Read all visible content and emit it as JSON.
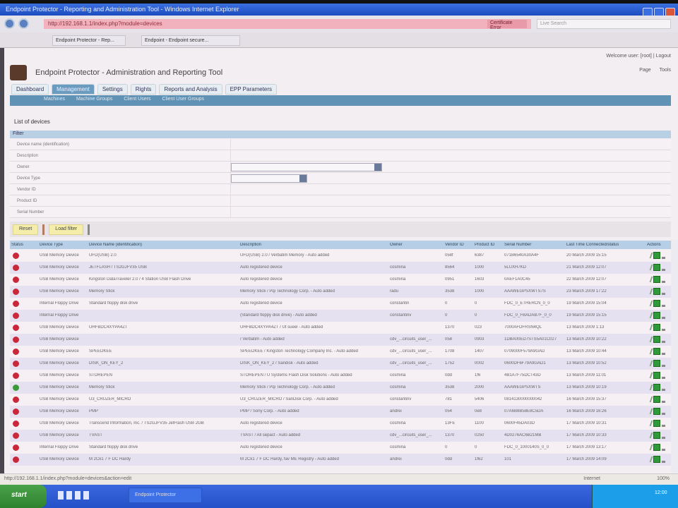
{
  "window": {
    "title": "Endpoint Protector - Reporting and Administration Tool - Windows Internet Explorer"
  },
  "browser": {
    "address": "http://192.168.1.1/index.php?module=devices",
    "cert_error": "Certificate Error",
    "search_placeholder": "Live Search",
    "tabs": [
      "Endpoint Protector - Rep...",
      "Endpoint - Endpoint secure..."
    ],
    "tools": [
      "Page",
      "Tools"
    ]
  },
  "header": {
    "welcome": "Welcome user: [root] | Logout",
    "app_title": "Endpoint Protector - Administration and Reporting Tool"
  },
  "main_tabs": [
    "Dashboard",
    "Management",
    "Settings",
    "Rights",
    "Reports and Analysis",
    "EPP Parameters"
  ],
  "active_tab": "Management",
  "sub_nav": [
    "Machines",
    "Machine Groups",
    "Client Users",
    "Client User Groups"
  ],
  "section_title": "List of devices",
  "filter": {
    "title": "Filter",
    "fields": [
      "Device name (identification)",
      "Description",
      "Owner",
      "Device Type",
      "Vendor ID",
      "Product ID",
      "Serial Number"
    ]
  },
  "buttons": {
    "reset": "Reset",
    "load_filter": "Load filter"
  },
  "table": {
    "columns": [
      "Status",
      "Device Type",
      "Device Name (identification)",
      "Description",
      "Owner",
      "Vendor ID",
      "Product ID",
      "Serial Number",
      "Last Time Connected/status",
      "Actions"
    ],
    "rows": [
      [
        "bad",
        "USB Memory Device",
        "UFD(USB) 2.0",
        "UFD(USB) 2.0 / Verbatim Memory - Auto added",
        "",
        "058f",
        "6387",
        "071B6540A30A4F",
        "20 March 2009 15:15"
      ],
      [
        "bad",
        "USB Memory Device",
        "JETFLASH / TS2GJFV35 USB",
        "Auto registered device",
        "cosmina",
        "8564",
        "1000",
        "5LUXH7KD",
        "21 March 2009 12:07"
      ],
      [
        "bad",
        "USB Memory Device",
        "Kingston DataTraveler 2.0 / 4 Station USB Flash Drive",
        "Auto registered device",
        "cosmina",
        "0951",
        "1603",
        "0AEF1A0C45",
        "22 March 2009 12:07"
      ],
      [
        "bad",
        "USB Memory Device",
        "Memory Stick",
        "Memory Stick / Pqi Technology Corp. - Auto added",
        "radu",
        "3538",
        "1000",
        "AAAWEGPSXWTS7S",
        "23 March 2009 17:22"
      ],
      [
        "bad",
        "Internal Floppy Drive",
        "Standard floppy disk drive",
        "Auto registered device",
        "constantin",
        "0",
        "0",
        "FDC_0_ETHERCN_0_0",
        "19 March 2009 15:04"
      ],
      [
        "bad",
        "Internal Floppy Drive",
        "",
        "(Standard floppy disk drive) - Auto added",
        "constantinv",
        "0",
        "0",
        "FDC_0_FBADAB7F_0_0",
        "19 March 2009 15:15"
      ],
      [
        "bad",
        "USB Memory Device",
        "UHFBDC4XYPA4ZT",
        "UHFBDC4XYPA4ZT / Ut sueel - Auto added",
        "",
        "1370",
        "023",
        "7000AFDFRSN4QL",
        "13 March 2009 1:13"
      ],
      [
        "bad",
        "USB Memory Device",
        "",
        "/ Verbatim - Auto added",
        "cdv_...circuits_user_...",
        "058",
        "0903",
        "1DBA00ED7STS5A01C027",
        "13 March 2009 10:22"
      ],
      [
        "bad",
        "USB Memory Device",
        "SPEEDKEE",
        "SPEEDKEE / Kingston Technology Company Inc. - Auto added",
        "cdv_...circuits_user_...",
        "1708",
        "1407",
        "0709000F579A9GAD",
        "13 March 2009 10:44"
      ],
      [
        "bad",
        "USB Memory Device",
        "DISK_ON_KEY_2",
        "DISK_ON_KEY_2 / Sandisk - Auto added",
        "cdv_...circuits_user_...",
        "1752",
        "0002",
        "0600DF6F79A9GAD1",
        "13 March 2009 10:52"
      ],
      [
        "bad",
        "USB Memory Device",
        "STOREPEN",
        "STOREPEN / U Systems Flash Disk Solutions - Auto added",
        "cosmina",
        "0dd",
        "1f6",
        "4B1A7F75DCT43D",
        "13 March 2009 11:01"
      ],
      [
        "ok",
        "USB Memory Device",
        "Memory Stick",
        "Memory Stick / Pqi Technology Corp. - Auto added",
        "cosmina",
        "3538",
        "2000",
        "AAAWEGPSXWTS",
        "13 March 2009 10:19"
      ],
      [
        "bad",
        "USB Memory Device",
        "U3_CRUZER_MICRO",
        "U3_CRUZER_MICRO / SanDisk Corp. - Auto added",
        "constantinv",
        "781",
        "5406",
        "0814130000000042",
        "16 March 2009 15:37"
      ],
      [
        "bad",
        "USB Memory Device",
        "PMP",
        "PMP / Sony Corp. - Auto added",
        "andrei",
        "054",
        "0e8",
        "07A6B8B58E8C5DA",
        "16 March 2009 16:26"
      ],
      [
        "bad",
        "USB Memory Device",
        "Transcend Information, Inc. / TS2GJFV35 JetFlash USB 2GB",
        "Auto registered device",
        "cosmina",
        "13FE",
        "1100",
        "0600F45DA03D",
        "17 March 2009 10:31"
      ],
      [
        "bad",
        "USB Memory Device",
        "TVAST",
        "TVAST / All sepact - Auto added",
        "cdv_...circuits_user_...",
        "1370",
        "0250",
        "4D0276AC6B21MB",
        "17 March 2009 10:33"
      ],
      [
        "bad",
        "Internal Floppy Drive",
        "Standard floppy disk drive",
        "Auto registered device",
        "cosmina",
        "0",
        "0",
        "FDC_0_1000140S_0_0",
        "17 March 2009 13:17"
      ],
      [
        "bad",
        "USB Memory Device",
        "M 2Ck1 7 F DC Hardy",
        "M 2Ck1 7 F DC Hardy, fav ME Registry - Auto added",
        "andrei",
        "0dd",
        "1f62",
        "101",
        "17 March 2009 14:09"
      ]
    ]
  },
  "status_bar": {
    "url": "http://192.168.1.1/index.php?module=devices&action=edit",
    "zone": "Internet",
    "zoom": "100%"
  },
  "taskbar": {
    "start": "start",
    "task": "Endpoint Protector",
    "clock": "12:00"
  }
}
